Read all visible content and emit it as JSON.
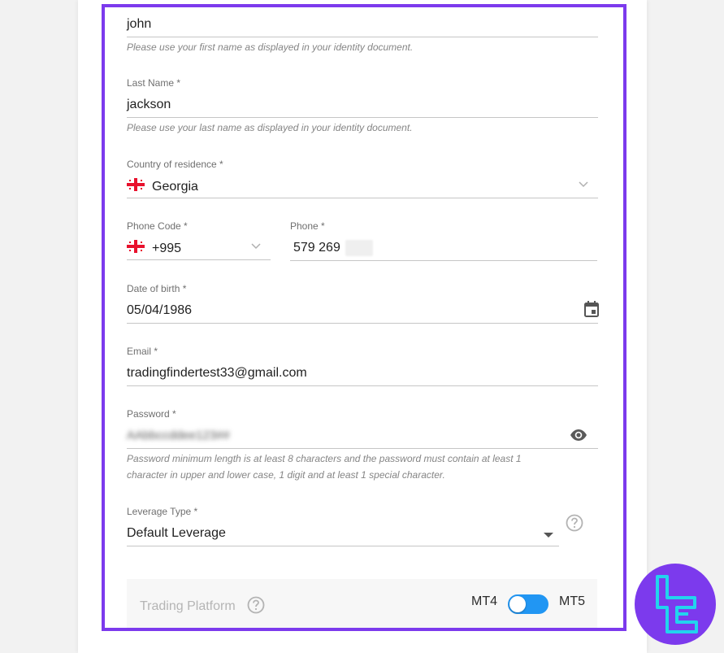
{
  "form": {
    "first_name": {
      "value": "john",
      "hint": "Please use your first name as displayed in your identity document."
    },
    "last_name": {
      "label": "Last Name *",
      "value": "jackson",
      "hint": "Please use your last name as displayed in your identity document."
    },
    "country": {
      "label": "Country of residence *",
      "value": "Georgia",
      "flag_icon": "georgia-flag-icon"
    },
    "phone_code": {
      "label": "Phone Code *",
      "value": "+995"
    },
    "phone": {
      "label": "Phone *",
      "value": "579 269"
    },
    "dob": {
      "label": "Date of birth *",
      "value": "05/04/1986"
    },
    "email": {
      "label": "Email *",
      "value": "tradingfindertest33@gmail.com"
    },
    "password": {
      "label": "Password *",
      "value": "AAbbccddee123##",
      "hint_line1": "Password minimum length is at least 8 characters and the password must contain at least 1",
      "hint_line2": "character in upper and lower case, 1 digit and at least 1 special character."
    },
    "leverage": {
      "label": "Leverage Type *",
      "value": "Default Leverage"
    },
    "trading_platform": {
      "label": "Trading Platform",
      "option_left": "MT4",
      "option_right": "MT5",
      "selected": "MT4"
    }
  },
  "colors": {
    "frame": "#7c3aed",
    "toggle": "#2196f3",
    "flag_red": "#e8112d"
  }
}
